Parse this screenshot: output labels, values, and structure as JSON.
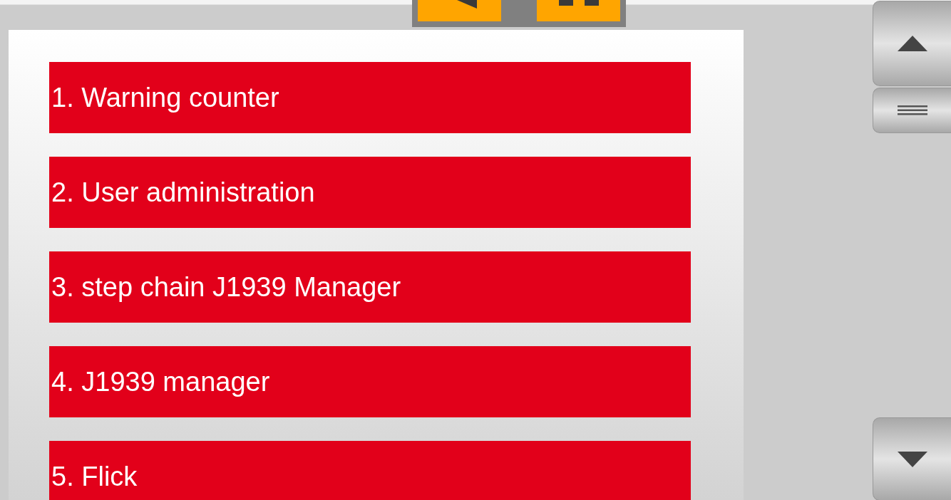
{
  "menu": {
    "items": [
      {
        "label": "1. Warning counter"
      },
      {
        "label": "2. User administration"
      },
      {
        "label": "3. step chain J1939 Manager"
      },
      {
        "label": "4. J1939 manager"
      },
      {
        "label": "5. Flick"
      }
    ]
  }
}
